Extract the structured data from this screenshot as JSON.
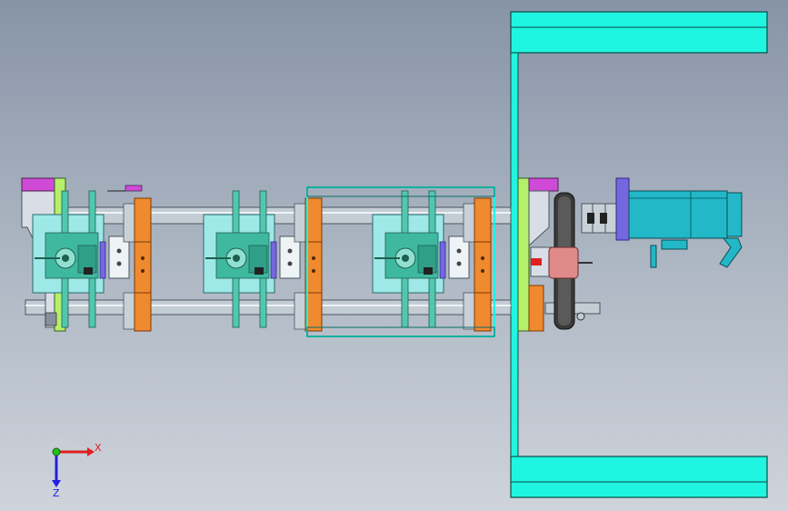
{
  "viewport": {
    "background_top": "#8794a8",
    "background_bottom": "#cfd4db"
  },
  "colors": {
    "cyan": "#1ff5e0",
    "teal_dark": "#1f8f78",
    "teal_mid": "#52c7b0",
    "light_cyan": "#9fe8e8",
    "orange": "#f08a2e",
    "rail": "#c4ccd4",
    "lime": "#b4f06a",
    "magenta": "#d04ad8",
    "purple": "#7468e0",
    "motor": "#22b8c8",
    "pink": "#e08a8a",
    "dark_gray": "#4a4a4a"
  },
  "triad": {
    "x_label": "X",
    "z_label": "Z",
    "x_color": "#e02020",
    "y_color": "#20c020",
    "z_color": "#2020e0",
    "icons": [
      "x-axis-arrow-icon",
      "y-axis-dot-icon",
      "z-axis-arrow-icon"
    ]
  }
}
